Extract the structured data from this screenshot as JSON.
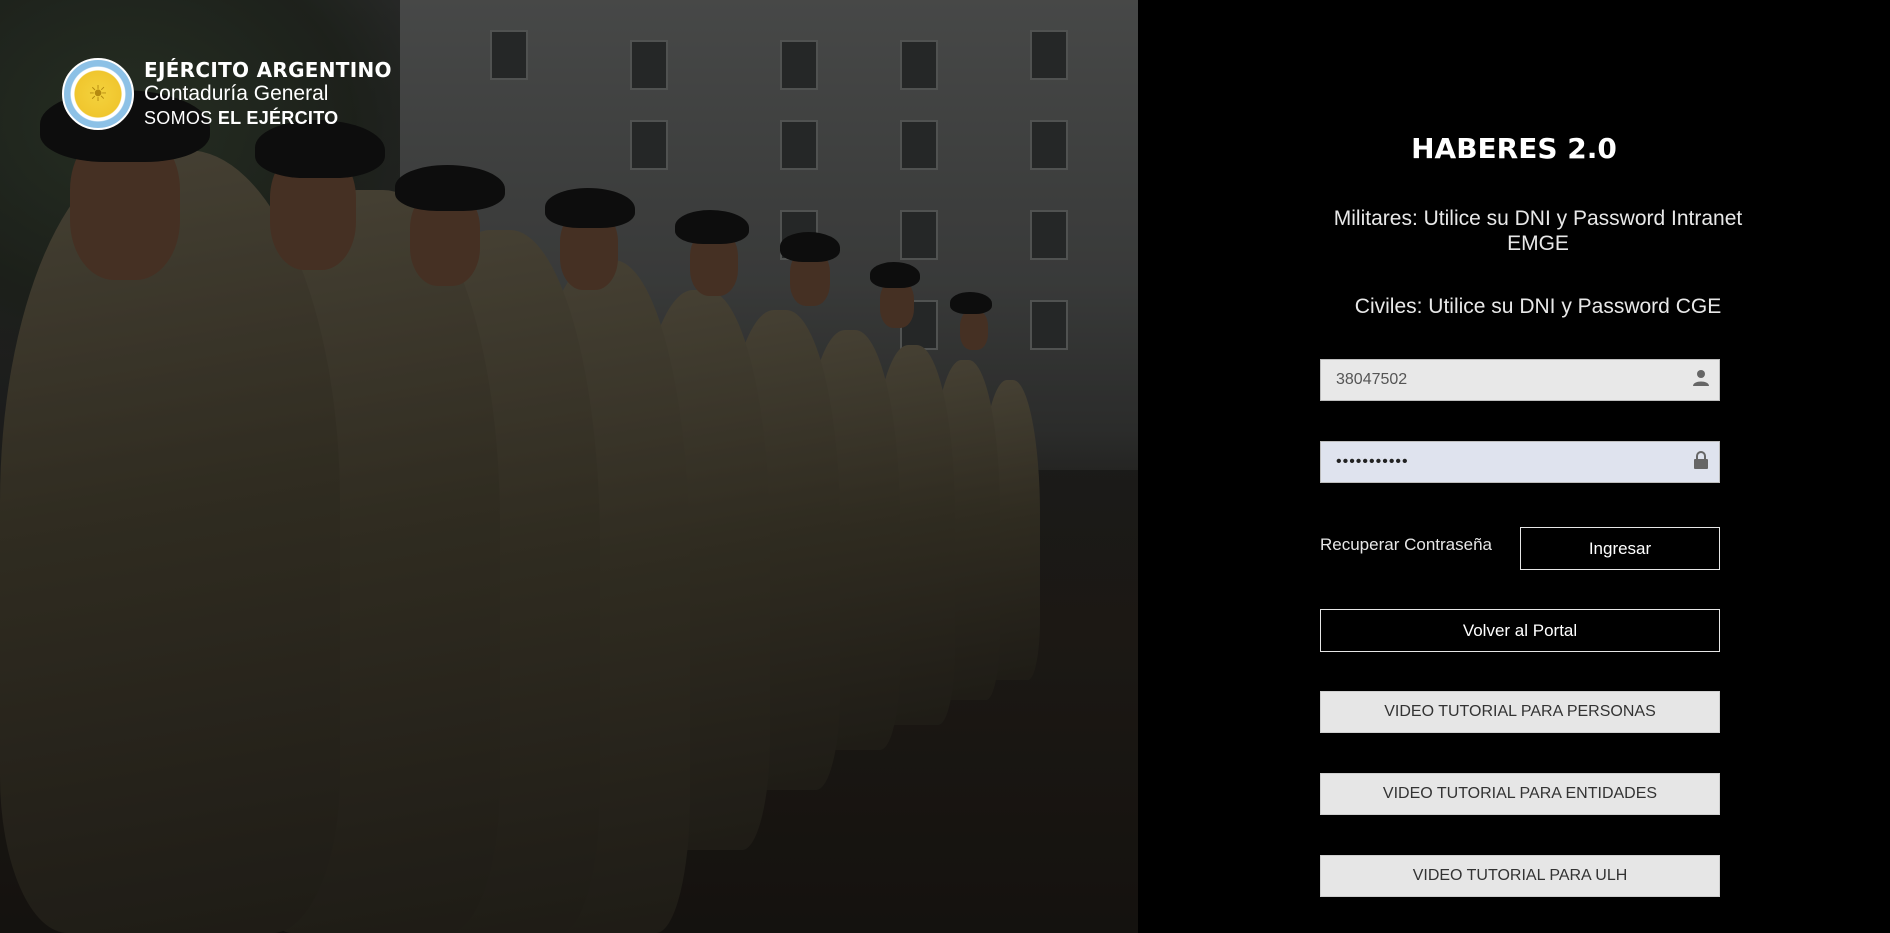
{
  "brand": {
    "line1": "EJÉRCITO ARGENTINO",
    "line2": "Contaduría General",
    "line3_prefix": "SOMOS ",
    "line3_bold": "EL EJÉRCITO"
  },
  "login": {
    "title": "HABERES 2.0",
    "info_militares": "Militares: Utilice su DNI y Password Intranet EMGE",
    "info_civiles": "Civiles: Utilice su DNI y Password CGE",
    "username_value": "38047502",
    "password_value": "•••••••••••",
    "recover_link": "Recuperar Contraseña",
    "login_button": "Ingresar",
    "portal_button": "Volver al Portal",
    "video_personas": "VIDEO TUTORIAL PARA PERSONAS",
    "video_entidades": "VIDEO TUTORIAL PARA ENTIDADES",
    "video_ulh": "VIDEO TUTORIAL PARA ULH"
  },
  "icons": {
    "user": "user-icon",
    "lock": "lock-icon"
  },
  "colors": {
    "panel_bg": "#000000",
    "field_bg": "#e8e8e8",
    "autofill_bg": "#dfe3ee",
    "button_grey": "#e6e6e6"
  }
}
